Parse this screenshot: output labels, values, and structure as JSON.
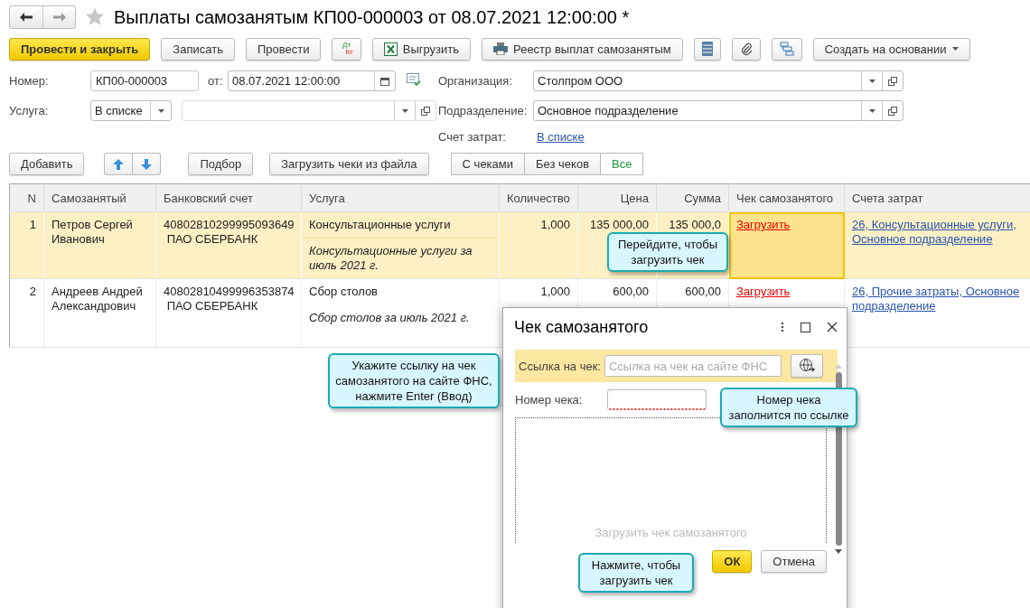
{
  "window": {
    "title": "Выплаты самозанятым КП00-000003 от 08.07.2021 12:00:00 *"
  },
  "toolbar": {
    "post_close": "Провести и закрыть",
    "save": "Записать",
    "post": "Провести",
    "dtkt": [
      "Дт",
      "Кт"
    ],
    "export": "Выгрузить",
    "registry": "Реестр выплат самозанятым",
    "create_based": "Создать на основании"
  },
  "form": {
    "number_label": "Номер:",
    "number": "КП00-000003",
    "date_label": "от:",
    "date": "08.07.2021 12:00:00",
    "service_label": "Услуга:",
    "service_mode": "В списке",
    "org_label": "Организация:",
    "org": "Столпром ООО",
    "dept_label": "Подразделение:",
    "dept": "Основное подразделение",
    "cost_label": "Счет затрат:",
    "cost_link": "В списке"
  },
  "table_toolbar": {
    "add": "Добавить",
    "pick": "Подбор",
    "load": "Загрузить чеки из файла",
    "filters": [
      {
        "label": "С чеками",
        "selected": false
      },
      {
        "label": "Без чеков",
        "selected": false
      },
      {
        "label": "Все",
        "selected": true
      }
    ]
  },
  "table": {
    "columns": [
      "N",
      "Самозанятый",
      "Банковский счет",
      "Услуга",
      "Количество",
      "Цена",
      "Сумма",
      "Чек самозанятого",
      "Счета затрат"
    ],
    "rows": [
      {
        "n": "1",
        "person": "Петров Сергей Иванович",
        "account": "40802810299995093649",
        "bank": "ПАО СБЕРБАНК",
        "service": "Консультационные услуги",
        "comment": "Консультационные услуги за июль 2021 г.",
        "qty": "1,000",
        "price": "135 000,00",
        "sum": "135 000,0",
        "receipt": "Загрузить",
        "costs": "26, Консультационные услуги, Основное подразделение",
        "selected": true,
        "focused": true
      },
      {
        "n": "2",
        "person": "Андреев Андрей Александрович",
        "account": "40802810499996353874",
        "bank": "ПАО СБЕРБАНК",
        "service": "Сбор столов",
        "comment": "Сбор столов за июль 2021 г.",
        "qty": "1,000",
        "price": "600,00",
        "sum": "600,00",
        "receipt": "Загрузить",
        "costs": "26, Прочие затраты, Основное подразделение",
        "selected": false,
        "focused": false
      }
    ]
  },
  "dialog": {
    "title": "Чек самозанятого",
    "link_label": "Ссылка на чек:",
    "link_placeholder": "Ссылка на чек на сайте ФНС",
    "number_label": "Номер чека:",
    "area_hint": "Загрузить чек самозанятого",
    "ok": "ОК",
    "cancel": "Отмена"
  },
  "callouts": [
    {
      "text": "Перейдите, чтобы загрузить чек"
    },
    {
      "text": "Укажите ссылку на чек самозанятого на сайте ФНС, нажмите Enter (Ввод)"
    },
    {
      "text": "Номер чека заполнится по ссылке"
    },
    {
      "text": "Нажмите, чтобы загрузить чек"
    }
  ]
}
